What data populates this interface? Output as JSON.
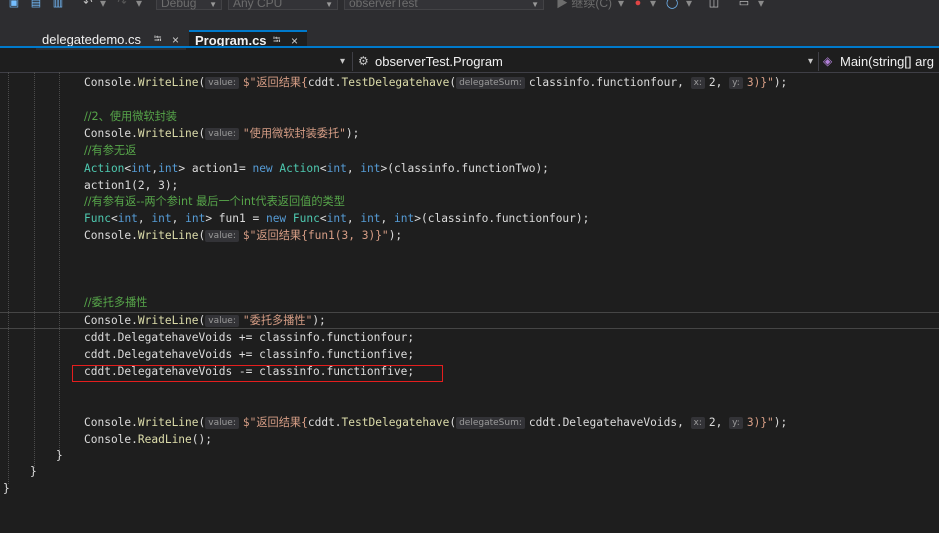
{
  "toolbar": {
    "config": "Debug",
    "platform": "Any CPU",
    "project": "observerTest",
    "run_label": "▶ 继续(C)"
  },
  "tabs": [
    {
      "label": "delegatedemo.cs",
      "pin": "⭾",
      "close": "×"
    },
    {
      "label": "Program.cs",
      "pin": "⭾",
      "close": "×"
    }
  ],
  "nav": {
    "class_name": "observerTest.Program",
    "method_name": "Main(string[] arg"
  },
  "code": {
    "l1": {
      "prefix": "Console.",
      "m": "WriteLine",
      "open": "(",
      "hint": "value:",
      "s1": "$\"返回结果{",
      "a": "cddt.",
      "m2": "TestDelegatehave",
      "o2": "(",
      "h2": "delegateSum:",
      "a2": "classinfo.",
      "a3": "functionfour",
      "c1": ", ",
      "h3": "x:",
      "n1": "2, ",
      "h4": "y:",
      "n2": "3)}\"",
      "end": ");"
    },
    "c2": "//2、使用微软封装",
    "l3": {
      "prefix": "Console.",
      "m": "WriteLine",
      "open": "(",
      "hint": "value:",
      "s": "\"使用微软封装委托\"",
      "end": ");"
    },
    "c4": "//有参无返",
    "l5": {
      "t1": "Action",
      "g1": "<",
      "k1": "int",
      "g2": ",",
      "k2": "int",
      "g3": "> action1= ",
      "kw": "new",
      "sp": " ",
      "t2": "Action",
      "g4": "<",
      "k3": "int",
      "g5": ", ",
      "k4": "int",
      "g6": ">(classinfo.",
      "m": "functionTwo",
      "end": ");"
    },
    "l6": "action1(2, 3);",
    "c7": "//有参有返--两个参int 最后一个int代表返回值的类型",
    "l8": {
      "t1": "Func",
      "g1": "<",
      "k1": "int",
      "g2": ", ",
      "k2": "int",
      "g3": ", ",
      "k3": "int",
      "g4": "> fun1 = ",
      "kw": "new",
      "sp": " ",
      "t2": "Func",
      "g5": "<",
      "k4": "int",
      "g6": ", ",
      "k5": "int",
      "g7": ", ",
      "k6": "int",
      "g8": ">(classinfo.",
      "m": "functionfour",
      "end": ");"
    },
    "l9": {
      "prefix": "Console.",
      "m": "WriteLine",
      "open": "(",
      "hint": "value:",
      "s": "$\"返回结果{fun1(3, 3)}\"",
      "end": ");"
    },
    "c10": "//委托多播性",
    "l11": {
      "prefix": "Console.",
      "m": "WriteLine",
      "open": "(",
      "hint": "value:",
      "s": "\"委托多播性\"",
      "end": ");"
    },
    "l12": {
      "a": "cddt.DelegatehaveVoids += classinfo.",
      "m": "functionfour",
      "end": ";"
    },
    "l13": {
      "a": "cddt.DelegatehaveVoids += classinfo.",
      "m": "functionfive",
      "end": ";"
    },
    "l14": {
      "a": "cddt.DelegatehaveVoids -= classinfo.",
      "m": "functionfive",
      "end": ";"
    },
    "l15": {
      "prefix": "Console.",
      "m": "WriteLine",
      "open": "(",
      "hint": "value:",
      "s1": "$\"返回结果{",
      "a": "cddt.",
      "m2": "TestDelegatehave",
      "o2": "(",
      "h2": "delegateSum:",
      "a2": "cddt.DelegatehaveVoids, ",
      "h3": "x:",
      "n1": "2, ",
      "h4": "y:",
      "n2": "3)}\"",
      "end": ");"
    },
    "l16": {
      "prefix": "Console.",
      "m": "ReadLine",
      "end": "();"
    },
    "brace": "}"
  }
}
